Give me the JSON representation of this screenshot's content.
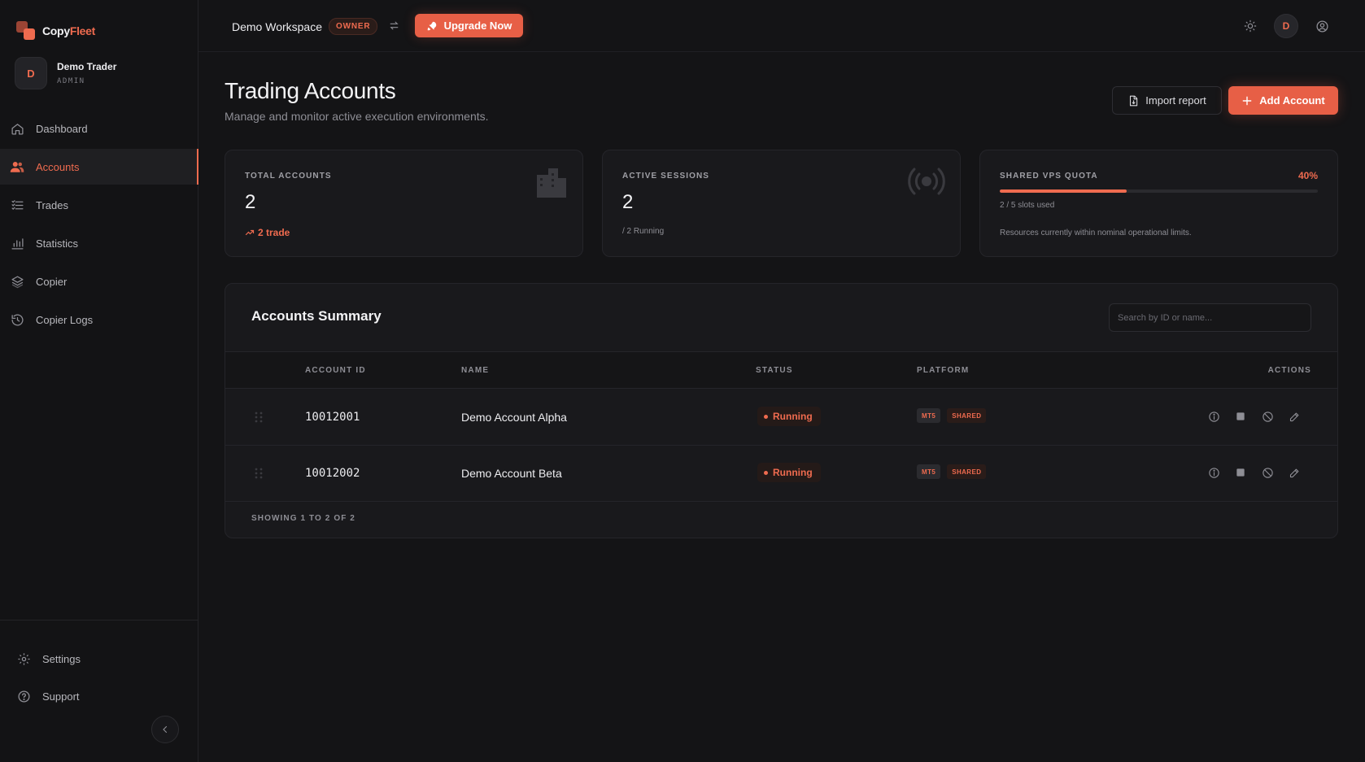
{
  "brand": {
    "name_part1": "Copy",
    "name_part2": "Fleet"
  },
  "profile": {
    "initial": "D",
    "name": "Demo Trader",
    "role": "ADMIN"
  },
  "sidebar": {
    "items": [
      {
        "label": "Dashboard",
        "icon": "home-icon"
      },
      {
        "label": "Accounts",
        "icon": "users-icon",
        "active": true
      },
      {
        "label": "Trades",
        "icon": "list-icon"
      },
      {
        "label": "Statistics",
        "icon": "bar-chart-icon"
      },
      {
        "label": "Copier",
        "icon": "layers-icon"
      },
      {
        "label": "Copier Logs",
        "icon": "history-icon"
      }
    ],
    "bottom": [
      {
        "label": "Settings",
        "icon": "gear-icon"
      },
      {
        "label": "Support",
        "icon": "help-icon"
      }
    ]
  },
  "topbar": {
    "workspace": "Demo Workspace",
    "role_badge": "OWNER",
    "upgrade_label": "Upgrade Now",
    "user_initial": "D"
  },
  "page": {
    "title": "Trading Accounts",
    "subtitle": "Manage and monitor active execution environments.",
    "import_label": "Import report",
    "add_label": "Add Account"
  },
  "stats": {
    "total": {
      "label": "TOTAL ACCOUNTS",
      "value": "2",
      "foot": "2 trade"
    },
    "sessions": {
      "label": "ACTIVE SESSIONS",
      "value": "2",
      "foot": "/ 2 Running"
    },
    "quota": {
      "label": "SHARED VPS QUOTA",
      "percent_text": "40%",
      "percent": 40,
      "used": "2 / 5 slots used",
      "note": "Resources currently within nominal operational limits."
    }
  },
  "table": {
    "title": "Accounts Summary",
    "search_placeholder": "Search by ID or name...",
    "headers": {
      "id": "ACCOUNT ID",
      "name": "NAME",
      "status": "STATUS",
      "platform": "PLATFORM",
      "actions": "ACTIONS"
    },
    "rows": [
      {
        "id": "10012001",
        "name": "Demo Account Alpha",
        "status": "Running",
        "platform": "MT5",
        "mode": "SHARED"
      },
      {
        "id": "10012002",
        "name": "Demo Account Beta",
        "status": "Running",
        "platform": "MT5",
        "mode": "SHARED"
      }
    ],
    "footer": "SHOWING 1 TO 2 OF 2"
  },
  "colors": {
    "accent": "#ef6b4f",
    "background": "#141416",
    "card": "#19191c"
  }
}
